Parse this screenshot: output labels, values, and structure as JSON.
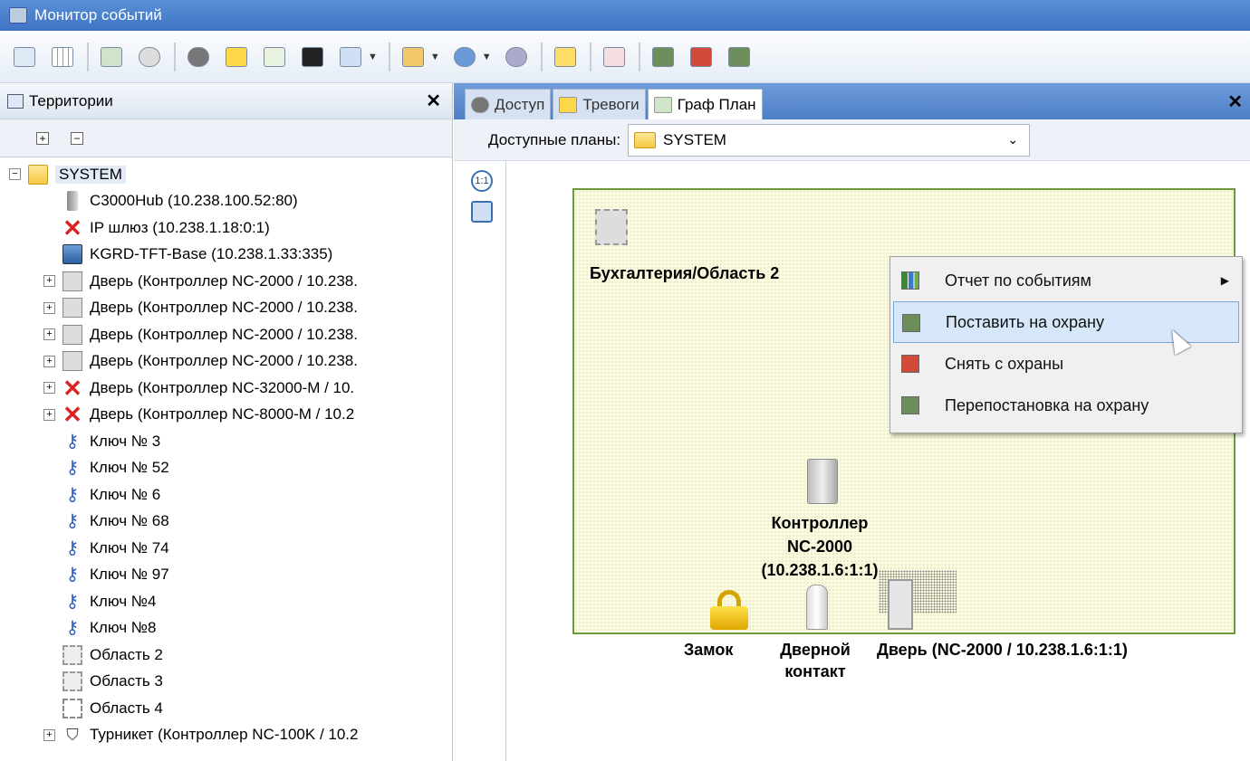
{
  "window": {
    "title": "Монитор событий"
  },
  "left_panel": {
    "title": "Территории",
    "close": "✕",
    "expand_all": "+",
    "collapse_all": "−",
    "tree": [
      {
        "label": "SYSTEM",
        "icon": "folder-icon",
        "level": 0,
        "expander": "−",
        "selected": true
      },
      {
        "label": "C3000Hub (10.238.100.52:80)",
        "icon": "hub-device-icon",
        "level": 1
      },
      {
        "label": "IP шлюз (10.238.1.18:0:1)",
        "icon": "error-x-icon",
        "level": 1
      },
      {
        "label": "KGRD-TFT-Base (10.238.1.33:335)",
        "icon": "monitor-icon",
        "level": 1
      },
      {
        "label": "Дверь (Контроллер NC-2000 / 10.238.",
        "icon": "door-icon",
        "level": 1,
        "expander": "+"
      },
      {
        "label": "Дверь (Контроллер NC-2000 / 10.238.",
        "icon": "door-icon",
        "level": 1,
        "expander": "+"
      },
      {
        "label": "Дверь (Контроллер NC-2000 / 10.238.",
        "icon": "door-icon",
        "level": 1,
        "expander": "+"
      },
      {
        "label": "Дверь (Контроллер NC-2000 / 10.238.",
        "icon": "door-icon",
        "level": 1,
        "expander": "+"
      },
      {
        "label": "Дверь (Контроллер NC-32000-M / 10.",
        "icon": "error-x-icon",
        "level": 1,
        "expander": "+"
      },
      {
        "label": "Дверь (Контроллер NC-8000-M / 10.2",
        "icon": "error-x-icon",
        "level": 1,
        "expander": "+"
      },
      {
        "label": "Ключ № 3",
        "icon": "key-icon",
        "level": 1
      },
      {
        "label": "Ключ № 52",
        "icon": "key-icon",
        "level": 1
      },
      {
        "label": "Ключ № 6",
        "icon": "key-icon",
        "level": 1
      },
      {
        "label": "Ключ № 68",
        "icon": "key-icon",
        "level": 1
      },
      {
        "label": "Ключ № 74",
        "icon": "key-icon",
        "level": 1
      },
      {
        "label": "Ключ № 97",
        "icon": "key-icon",
        "level": 1
      },
      {
        "label": "Ключ №4",
        "icon": "key-icon",
        "level": 1
      },
      {
        "label": "Ключ №8",
        "icon": "key-icon",
        "level": 1
      },
      {
        "label": "Область 2",
        "icon": "area-icon",
        "level": 1
      },
      {
        "label": "Область 3",
        "icon": "area-icon",
        "level": 1
      },
      {
        "label": "Область 4",
        "icon": "area-empty-icon",
        "level": 1
      },
      {
        "label": "Турникет (Контроллер NC-100K / 10.2",
        "icon": "turnstile-icon",
        "level": 1,
        "expander": "+"
      }
    ]
  },
  "tabs": [
    {
      "label": "Доступ",
      "icon": "access-icon"
    },
    {
      "label": "Тревоги",
      "icon": "alarm-icon"
    },
    {
      "label": "Граф План",
      "icon": "plan-icon",
      "active": true
    }
  ],
  "tabs_close": "✕",
  "plans": {
    "label": "Доступные планы:",
    "selected": "SYSTEM",
    "chevron": "⌄"
  },
  "plan_tools": {
    "zoom_1_1": "1:1",
    "zoom_fit": ""
  },
  "plan_objects": {
    "area_label": "Бухгалтерия/Область 2",
    "controller_label_1": "Контроллер",
    "controller_label_2": "NC-2000",
    "controller_label_3": "(10.238.1.6:1:1)",
    "lock_label": "Замок",
    "contact_label_1": "Дверной",
    "contact_label_2": "контакт",
    "door_label": "Дверь (NC-2000 / 10.238.1.6:1:1)"
  },
  "context_menu": {
    "items": [
      {
        "label": "Отчет по событиям",
        "icon": "report-icon",
        "submenu_arrow": "▶"
      },
      {
        "label": "Поставить на охрану",
        "icon": "arm-icon",
        "highlighted": true
      },
      {
        "label": "Снять с охраны",
        "icon": "disarm-icon"
      },
      {
        "label": "Перепостановка на охрану",
        "icon": "rearm-icon"
      }
    ]
  },
  "colors": {
    "titlebar": "#3f74c4",
    "plan_border": "#6a9a3a",
    "plan_fill": "#fbfbdf",
    "highlight": "#d6e7fa"
  }
}
